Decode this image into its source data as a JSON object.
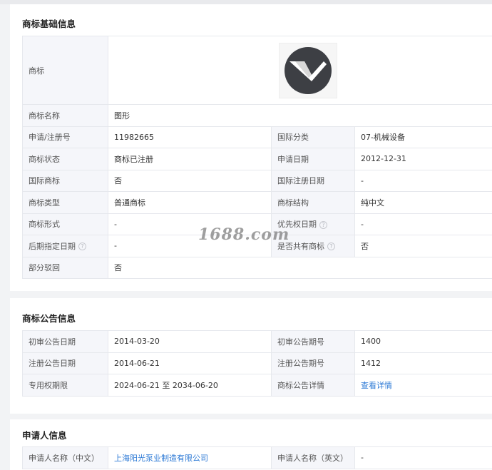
{
  "basic": {
    "title": "商标基础信息",
    "rows": {
      "logo_label": "商标",
      "name_label": "商标名称",
      "name": "图形",
      "regno_label": "申请/注册号",
      "regno": "11982665",
      "intl_class_label": "国际分类",
      "intl_class": "07-机械设备",
      "status_label": "商标状态",
      "status": "商标已注册",
      "apply_date_label": "申请日期",
      "apply_date": "2012-12-31",
      "intl_mark_label": "国际商标",
      "intl_mark": "否",
      "intl_reg_date_label": "国际注册日期",
      "intl_reg_date": "-",
      "type_label": "商标类型",
      "type": "普通商标",
      "structure_label": "商标结构",
      "structure": "纯中文",
      "form_label": "商标形式",
      "form": "-",
      "priority_date_label": "优先权日期",
      "priority_date": "-",
      "later_date_label": "后期指定日期",
      "later_date": "-",
      "shared_label": "是否共有商标",
      "shared": "否",
      "partial_reject_label": "部分驳回",
      "partial_reject": "否"
    }
  },
  "announce": {
    "title": "商标公告信息",
    "first_date_label": "初审公告日期",
    "first_date": "2014-03-20",
    "first_no_label": "初审公告期号",
    "first_no": "1400",
    "reg_date_label": "注册公告日期",
    "reg_date": "2014-06-21",
    "reg_no_label": "注册公告期号",
    "reg_no": "1412",
    "term_label": "专用权期限",
    "term": "2024-06-21 至 2034-06-20",
    "detail_label": "商标公告详情",
    "detail_link": "查看详情"
  },
  "applicant": {
    "title": "申请人信息",
    "name_cn_label": "申请人名称（中文）",
    "name_cn": "上海阳光泵业制造有限公司",
    "name_en_label": "申请人名称（英文）",
    "name_en": "-"
  },
  "watermark": "1688.com",
  "icons": {
    "help": "help-circle-icon"
  }
}
